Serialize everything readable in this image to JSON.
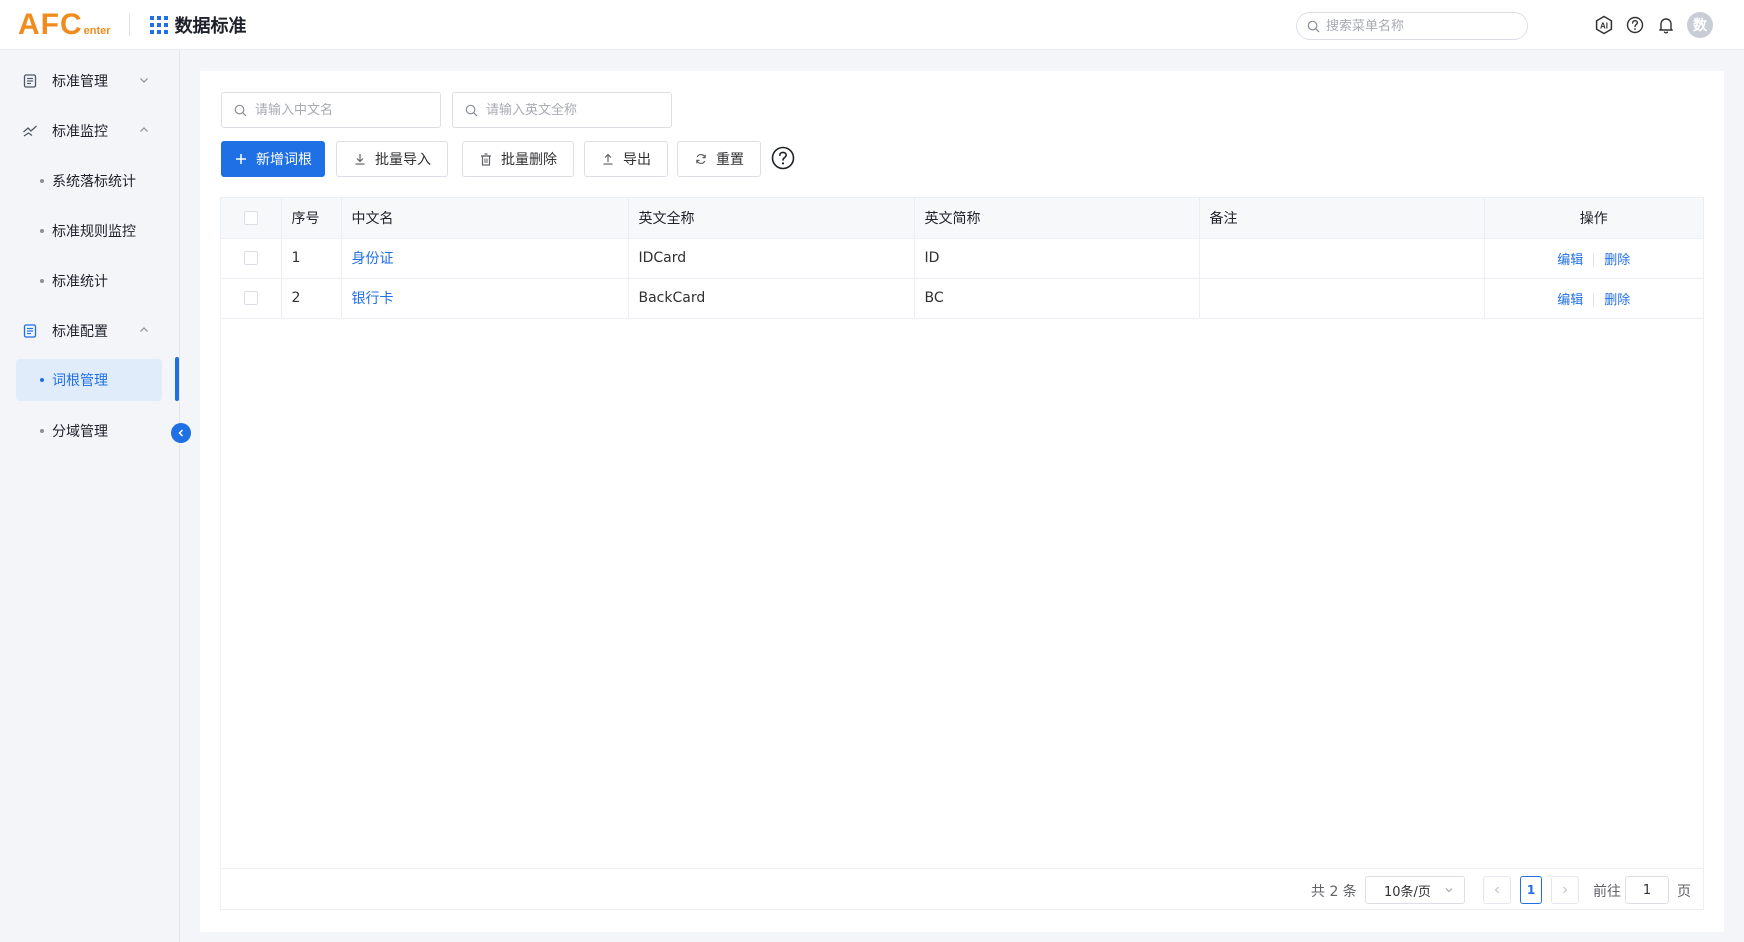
{
  "header": {
    "logo_main": "AFC",
    "logo_sub": "enter",
    "app_title": "数据标准",
    "search_placeholder": "搜索菜单名称",
    "avatar_text": "数",
    "ai_label": "AI"
  },
  "sidebar": {
    "items": [
      {
        "label": "标准管理",
        "icon": "document-icon",
        "expanded": false
      },
      {
        "label": "标准监控",
        "icon": "monitor-icon",
        "expanded": true
      },
      {
        "label": "系统落标统计",
        "sub": true
      },
      {
        "label": "标准规则监控",
        "sub": true
      },
      {
        "label": "标准统计",
        "sub": true
      },
      {
        "label": "标准配置",
        "icon": "document-icon",
        "expanded": true
      },
      {
        "label": "词根管理",
        "sub": true,
        "active": true
      },
      {
        "label": "分域管理",
        "sub": true
      }
    ]
  },
  "filters": {
    "cn_name_placeholder": "请输入中文名",
    "en_name_placeholder": "请输入英文全称"
  },
  "toolbar": {
    "add_label": "新增词根",
    "import_label": "批量导入",
    "delete_label": "批量删除",
    "export_label": "导出",
    "reset_label": "重置"
  },
  "table": {
    "columns": [
      "序号",
      "中文名",
      "英文全称",
      "英文简称",
      "备注",
      "操作"
    ],
    "rows": [
      {
        "index": "1",
        "cn_name": "身份证",
        "en_full": "IDCard",
        "en_short": "ID",
        "remark": ""
      },
      {
        "index": "2",
        "cn_name": "银行卡",
        "en_full": "BackCard",
        "en_short": "BC",
        "remark": ""
      }
    ],
    "edit_label": "编辑",
    "delete_label": "删除"
  },
  "pagination": {
    "total_text": "共 2 条",
    "page_size": "10条/页",
    "current_page": "1",
    "goto_label": "前往",
    "goto_value": "1",
    "page_suffix": "页"
  },
  "colors": {
    "primary": "#1f6fe5",
    "logo": "#f08c1e"
  }
}
